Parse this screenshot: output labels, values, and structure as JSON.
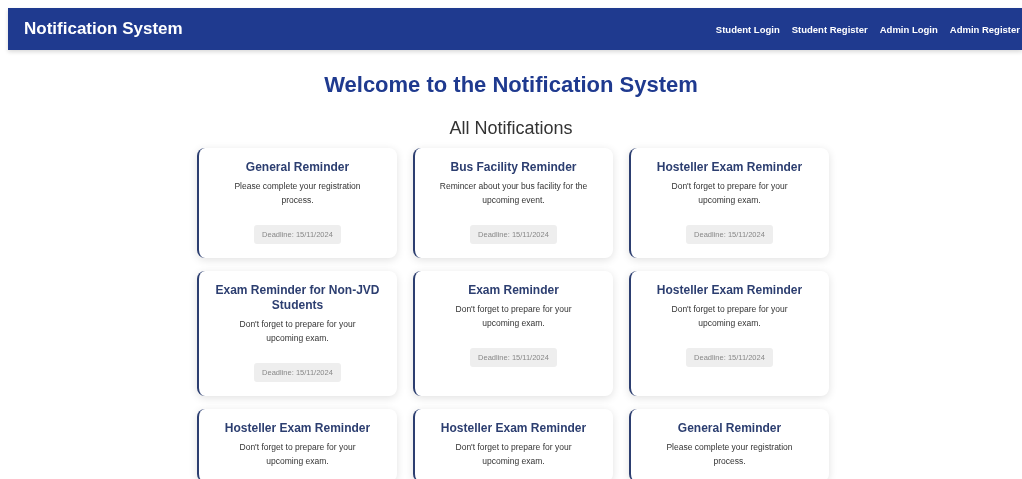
{
  "navbar": {
    "title": "Notification System",
    "links": [
      "Student Login",
      "Student Register",
      "Admin Login",
      "Admin Register"
    ]
  },
  "heading": "Welcome to the Notification System",
  "section_title": "All Notifications",
  "notifications": [
    {
      "title": "General Reminder",
      "message": "Please complete your registration process.",
      "deadline": "Deadline: 15/11/2024"
    },
    {
      "title": "Bus Facility Reminder",
      "message": "Remincer about your bus facility for the upcoming event.",
      "deadline": "Deadline: 15/11/2024"
    },
    {
      "title": "Hosteller Exam Reminder",
      "message": "Don't forget to prepare for your upcoming exam.",
      "deadline": "Deadline: 15/11/2024"
    },
    {
      "title": "Exam Reminder for Non-JVD Students",
      "message": "Don't forget to prepare for your upcoming exam.",
      "deadline": "Deadline: 15/11/2024"
    },
    {
      "title": "Exam Reminder",
      "message": "Don't forget to prepare for your upcoming exam.",
      "deadline": "Deadline: 15/11/2024"
    },
    {
      "title": "Hosteller Exam Reminder",
      "message": "Don't forget to prepare for your upcoming exam.",
      "deadline": "Deadline: 15/11/2024"
    },
    {
      "title": "Hosteller Exam Reminder",
      "message": "Don't forget to prepare for your upcoming exam."
    },
    {
      "title": "Hosteller Exam Reminder",
      "message": "Don't forget to prepare for your upcoming exam."
    },
    {
      "title": "General Reminder",
      "message": "Please complete your registration process."
    }
  ]
}
